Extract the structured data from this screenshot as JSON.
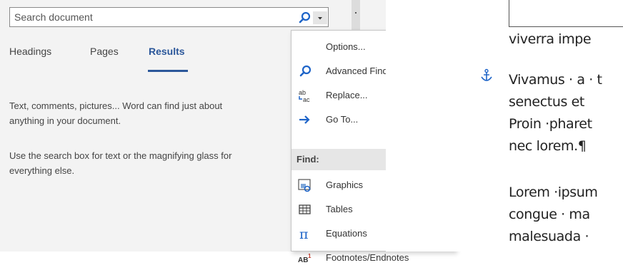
{
  "search": {
    "placeholder": "Search document"
  },
  "tabs": [
    {
      "label": "Headings"
    },
    {
      "label": "Pages"
    },
    {
      "label": "Results"
    }
  ],
  "help": {
    "p1": [
      "Text, comments, pictures... Word can find just about",
      "anything in your document."
    ],
    "p2": [
      "Use the search box for text or the magnifying glass for",
      "everything else."
    ]
  },
  "menu": {
    "items": [
      {
        "label": "Options...",
        "icon": "none"
      },
      {
        "label": "Advanced Find...",
        "icon": "magnifier-icon"
      },
      {
        "label": "Replace...",
        "icon": "replace-icon"
      },
      {
        "label": "Go To...",
        "icon": "arrow-right-icon"
      }
    ],
    "find_header": "Find:",
    "find_items": [
      {
        "label": "Graphics",
        "icon": "graphics-icon"
      },
      {
        "label": "Tables",
        "icon": "table-icon"
      },
      {
        "label": "Equations",
        "icon": "pi-icon"
      },
      {
        "label": "Footnotes/Endnotes",
        "icon": "footnote-icon"
      }
    ]
  },
  "document": {
    "lines": [
      "viverra impe",
      "Vivamus · a · t",
      "senectus et ",
      "Proin ·pharet",
      "nec lorem.¶",
      "Lorem ·ipsum",
      "congue · ma",
      "malesuada ·"
    ]
  },
  "colors": {
    "accent": "#2b579a",
    "icon_blue": "#1e64c8"
  }
}
